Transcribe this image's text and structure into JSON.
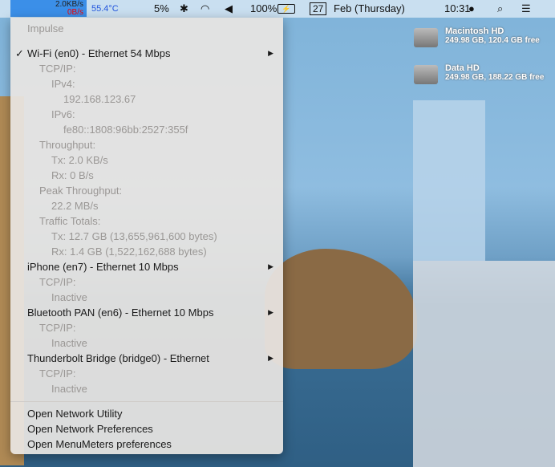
{
  "menubar": {
    "meter_tx": "2.0KB/s",
    "meter_rx": "0B/s",
    "temperature": "55.4°C",
    "cpu": "5%",
    "battery": "100%",
    "date_day": "27",
    "date_text": "Feb (Thursday)",
    "time": "10:31"
  },
  "desktop": {
    "drives": [
      {
        "name": "Macintosh HD",
        "info": "249.98 GB, 120.4 GB free"
      },
      {
        "name": "Data HD",
        "info": "249.98 GB, 188.22 GB free"
      }
    ]
  },
  "menu": {
    "header": "Impulse",
    "items": [
      {
        "label": "Wi-Fi (en0) - Ethernet 54 Mbps",
        "checked": true,
        "submenu": true
      },
      {
        "label": "TCP/IP:"
      },
      {
        "label": "IPv4:"
      },
      {
        "label": "192.168.123.67"
      },
      {
        "label": "IPv6:"
      },
      {
        "label": "fe80::1808:96bb:2527:355f"
      },
      {
        "label": "Throughput:"
      },
      {
        "label": "Tx: 2.0 KB/s"
      },
      {
        "label": "Rx: 0 B/s"
      },
      {
        "label": "Peak Throughput:"
      },
      {
        "label": "22.2 MB/s"
      },
      {
        "label": "Traffic Totals:"
      },
      {
        "label": "Tx: 12.7 GB (13,655,961,600 bytes)"
      },
      {
        "label": "Rx: 1.4 GB (1,522,162,688 bytes)"
      },
      {
        "label": "iPhone (en7) - Ethernet 10 Mbps",
        "submenu": true
      },
      {
        "label": "TCP/IP:"
      },
      {
        "label": "Inactive"
      },
      {
        "label": "Bluetooth PAN (en6) - Ethernet 10 Mbps",
        "submenu": true
      },
      {
        "label": "TCP/IP:"
      },
      {
        "label": "Inactive"
      },
      {
        "label": "Thunderbolt Bridge (bridge0) - Ethernet",
        "submenu": true
      },
      {
        "label": "TCP/IP:"
      },
      {
        "label": "Inactive"
      }
    ],
    "actions": [
      "Open Network Utility",
      "Open Network Preferences",
      "Open MenuMeters preferences"
    ]
  }
}
